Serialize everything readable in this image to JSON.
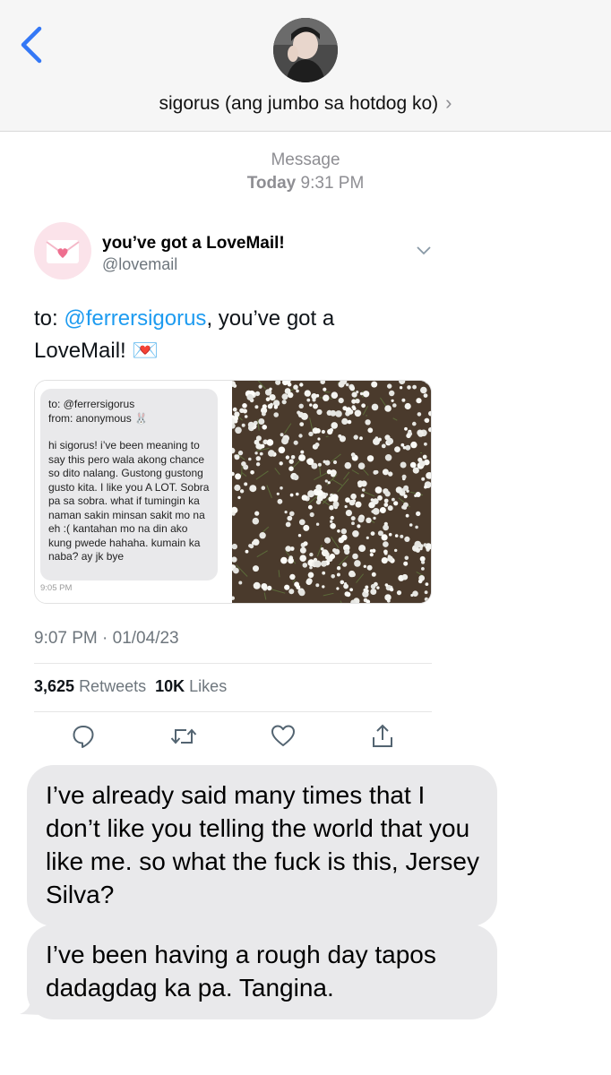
{
  "header": {
    "contact_name": "sigorus (ang jumbo sa hotdog ko)",
    "chevron": "›"
  },
  "meta": {
    "service": "Message",
    "day": "Today",
    "time": "9:31 PM"
  },
  "tweet": {
    "account_name": "you’ve got a LoveMail!",
    "account_handle": "@lovemail",
    "text_prefix": "to: ",
    "mention": "@ferrersigorus",
    "text_suffix": ", you’ve got a LoveMail!",
    "emoji": "💌",
    "note": {
      "to_line": "to: @ferrersigorus",
      "from_line": "from: anonymous 🐰",
      "body": "hi sigorus! i’ve been meaning to say this pero wala akong chance so dito nalang. Gustong gustong gusto kita. I like you A LOT. Sobra pa sa sobra. what if tumingin ka naman sakin minsan sakit mo na eh :( kantahan mo na din ako kung pwede hahaha. kumain ka naba? ay jk bye",
      "time": "9:05 PM"
    },
    "timestamp": "9:07 PM · 01/04/23",
    "retweets_count": "3,625",
    "retweets_label": "Retweets",
    "likes_count": "10K",
    "likes_label": "Likes",
    "icons": [
      "reply-icon",
      "retweet-icon",
      "like-icon",
      "share-icon"
    ]
  },
  "messages": [
    "I’ve already said many times that I don’t like you telling the world that you like me. so what the fuck is this, Jersey Silva?",
    "I’ve been having a rough day tapos dadagdag ka pa. Tangina."
  ],
  "colors": {
    "accent_blue": "#1d9bf0",
    "ios_blue": "#3478f6",
    "bubble_gray": "#e9e9eb",
    "meta_gray": "#8e8e93"
  }
}
